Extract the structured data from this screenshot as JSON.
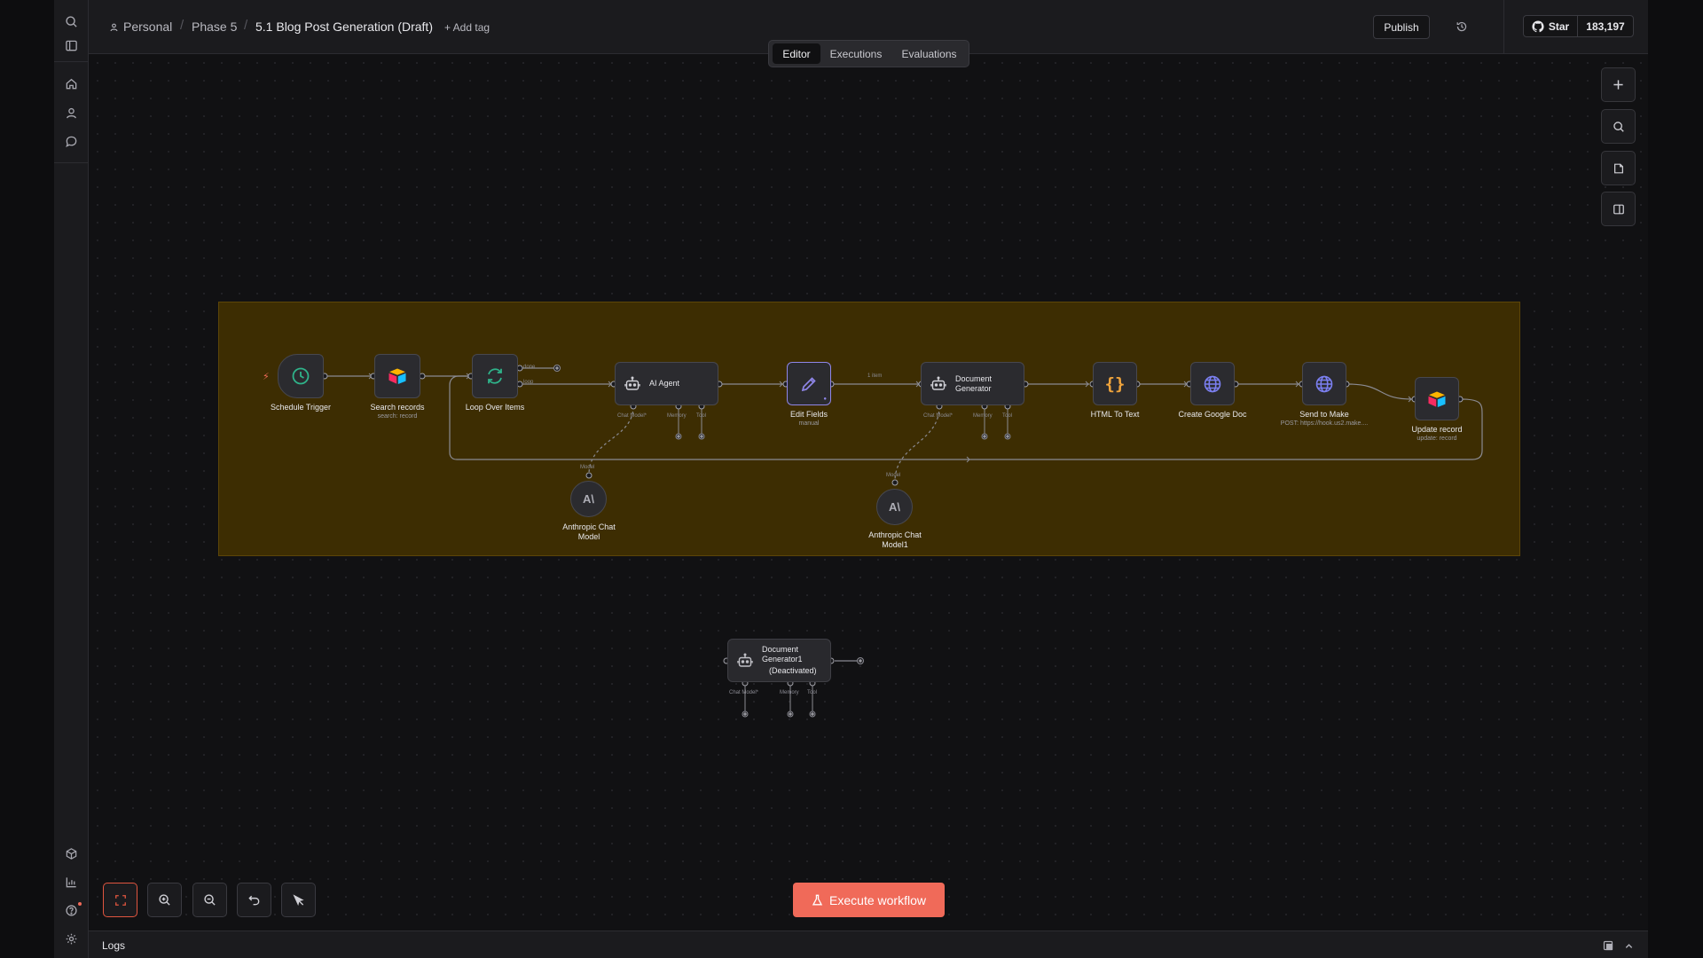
{
  "header": {
    "breadcrumb": {
      "project": "Personal",
      "folder": "Phase 5",
      "workflow": "5.1 Blog Post Generation (Draft)"
    },
    "add_tag": "+ Add tag",
    "publish": "Publish",
    "github": {
      "star": "Star",
      "count": "183,197"
    }
  },
  "tabs": [
    "Editor",
    "Executions",
    "Evaluations"
  ],
  "active_tab": "Editor",
  "nodes": {
    "schedule": {
      "label": "Schedule Trigger"
    },
    "search": {
      "label": "Search records",
      "sub": "search: record"
    },
    "loop": {
      "label": "Loop Over Items",
      "done": "done",
      "loop": "loop"
    },
    "agent": {
      "label": "AI Agent",
      "chat_model": "Chat Model*",
      "memory": "Memory",
      "tool": "Tool"
    },
    "edit": {
      "label": "Edit Fields",
      "sub": "manual"
    },
    "edge_item": "1 item",
    "docgen": {
      "label1": "Document",
      "label2": "Generator",
      "chat_model": "Chat Model*",
      "memory": "Memory",
      "tool": "Tool"
    },
    "html": {
      "label": "HTML To Text"
    },
    "gdoc": {
      "label": "Create Google Doc"
    },
    "make": {
      "label": "Send to Make",
      "sub": "POST: https://hook.us2.make...."
    },
    "update": {
      "label": "Update record",
      "sub": "update: record"
    },
    "anthropic1": {
      "label1": "Anthropic Chat",
      "label2": "Model",
      "model": "Model"
    },
    "anthropic2": {
      "label1": "Anthropic Chat",
      "label2": "Model1",
      "model": "Model"
    },
    "docgen1": {
      "label1": "Document",
      "label2": "Generator1",
      "status": "(Deactivated)",
      "chat_model": "Chat Model*",
      "memory": "Memory",
      "tool": "Tool"
    }
  },
  "execute_button": "Execute workflow",
  "logs": {
    "title": "Logs"
  },
  "colors": {
    "accent": "#f06a59",
    "sticky": "#3d2d02",
    "schedule": "#2fb38a",
    "edit": "#8f86e8",
    "html": "#f0a43c",
    "globe": "#7b7ff0"
  }
}
